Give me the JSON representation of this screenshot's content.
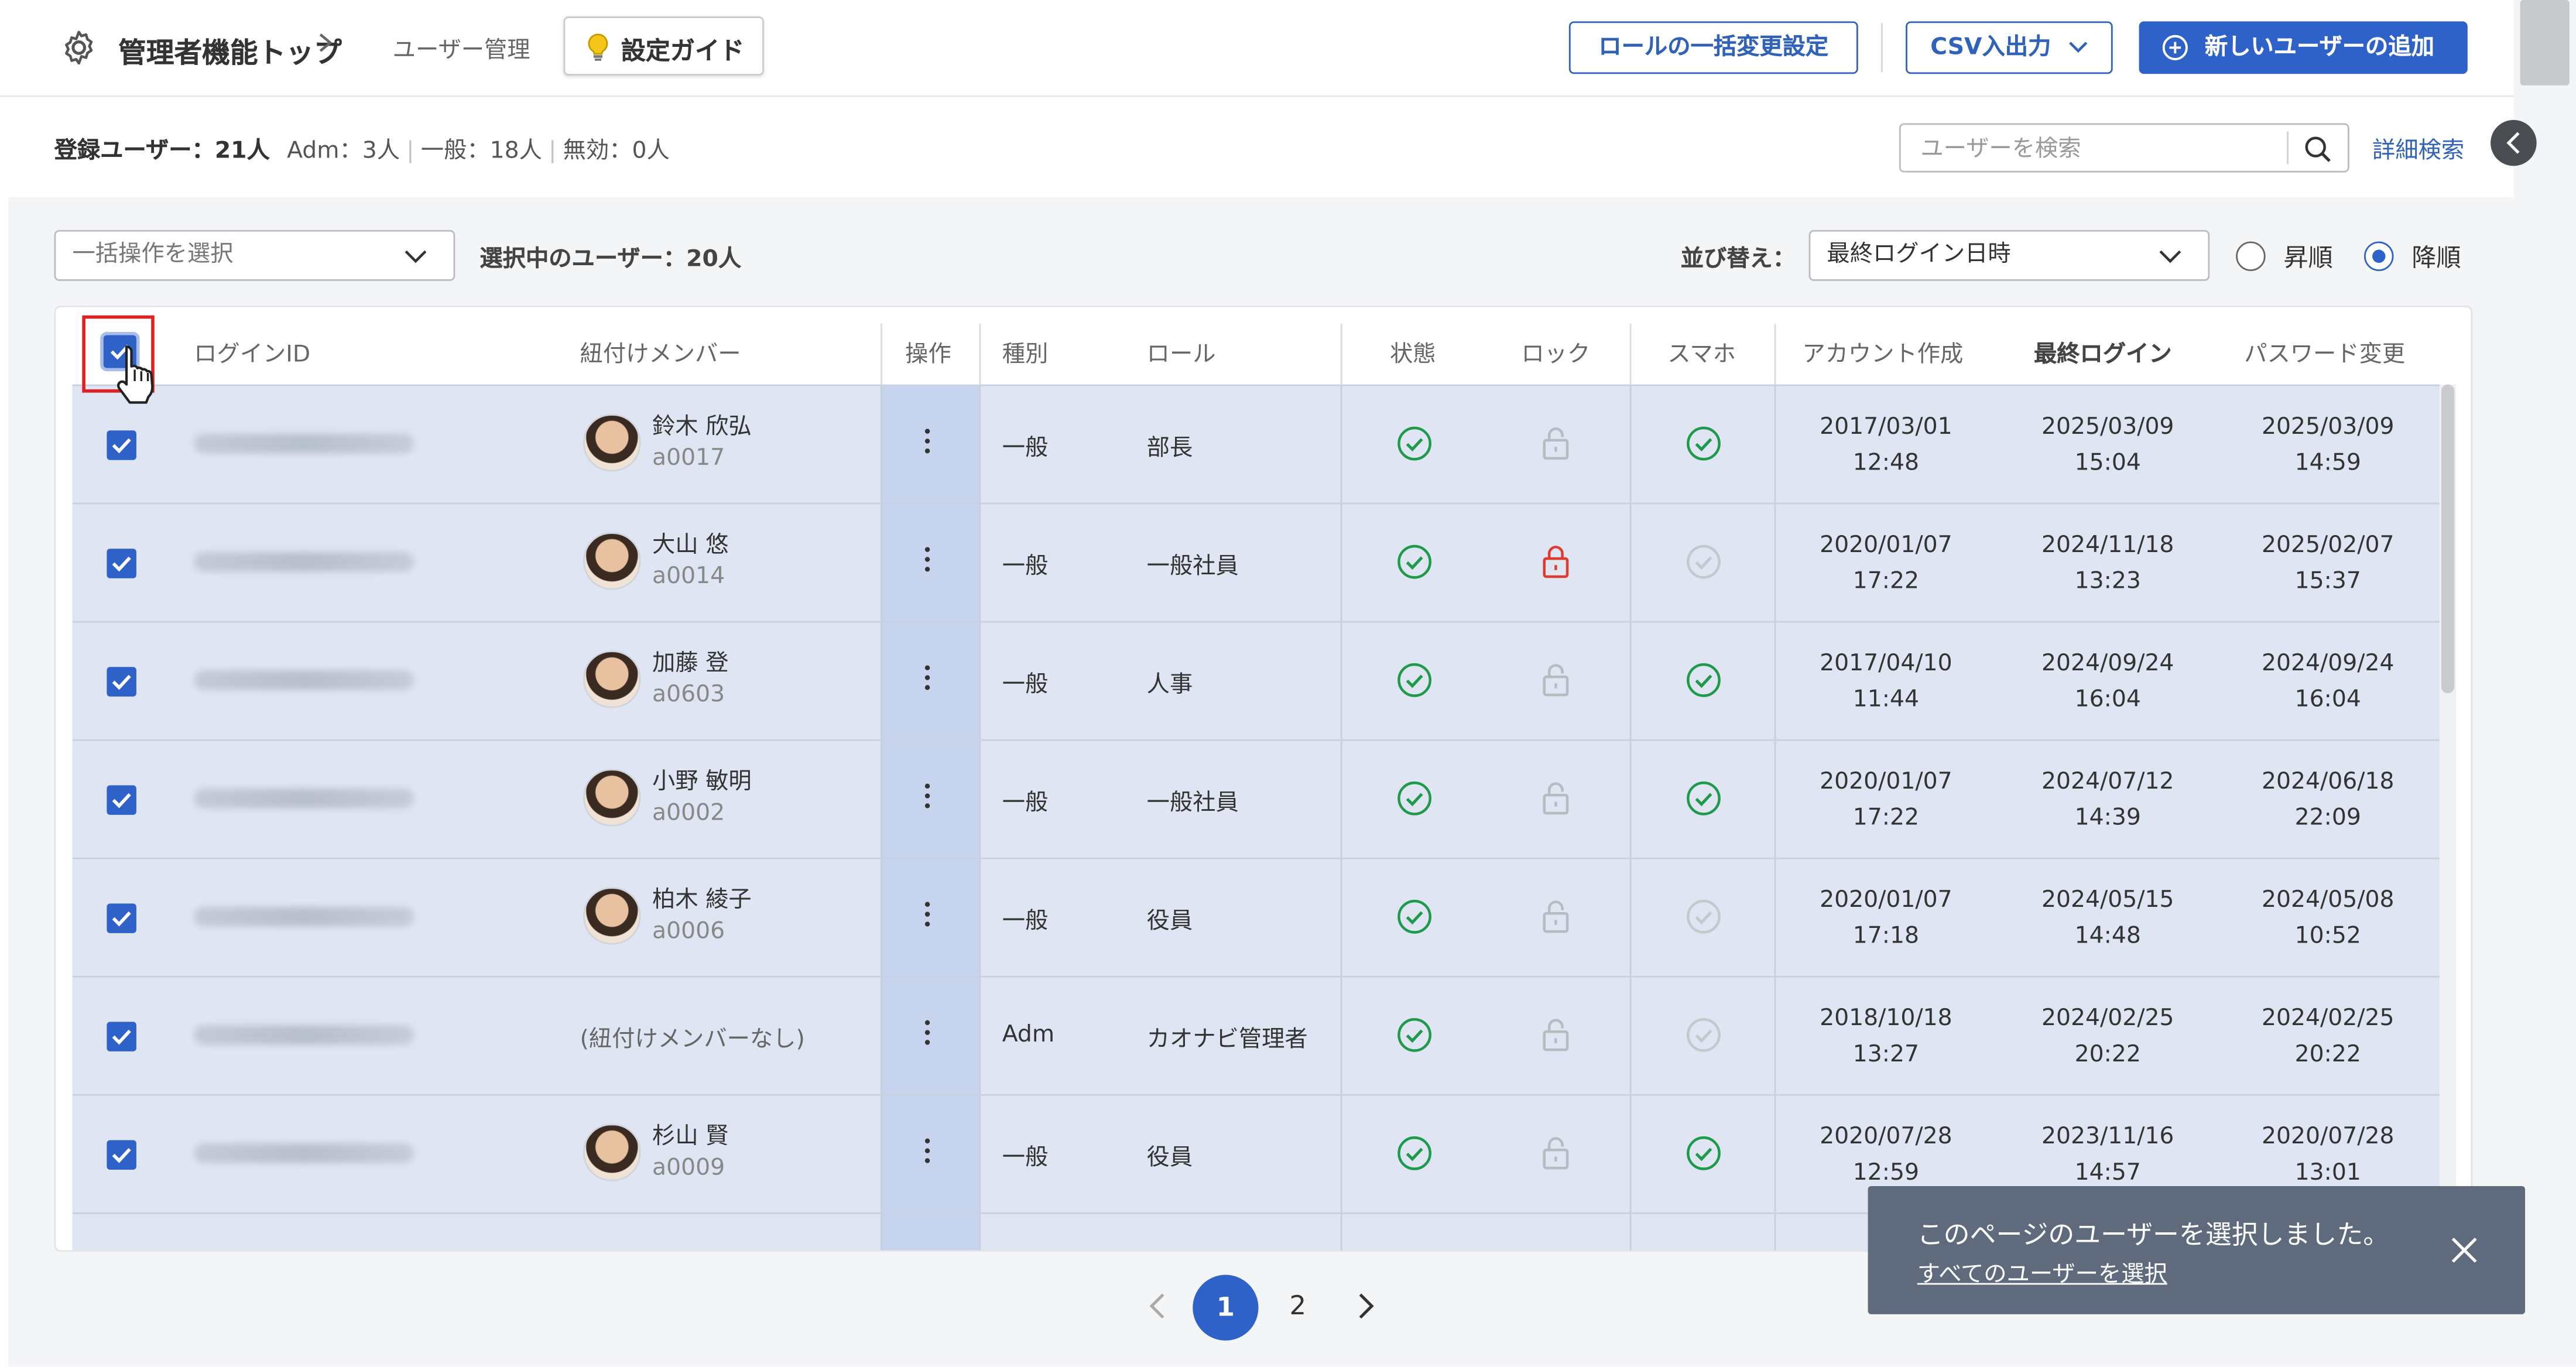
{
  "header": {
    "breadcrumb_top": "管理者機能トップ",
    "breadcrumb_current": "ユーザー管理",
    "guide_button": "設定ガイド",
    "role_bulk_button": "ロールの一括変更設定",
    "csv_button": "CSV入出力",
    "add_user_button": "新しいユーザーの追加"
  },
  "stats": {
    "registered_label": "登録ユーザー：21人",
    "adm": "Adm：3人",
    "general": "一般：18人",
    "disabled": "無効：0人"
  },
  "search": {
    "placeholder": "ユーザーを検索",
    "advanced_link": "詳細検索"
  },
  "toolbar": {
    "bulk_action_placeholder": "一括操作を選択",
    "selected_count": "選択中のユーザー：20人",
    "sort_label": "並び替え：",
    "sort_value": "最終ログイン日時",
    "asc_label": "昇順",
    "desc_label": "降順",
    "sort_order": "desc"
  },
  "table": {
    "columns": [
      "ログインID",
      "紐付けメンバー",
      "操作",
      "種別",
      "ロール",
      "状態",
      "ロック",
      "スマホ",
      "アカウント作成",
      "最終ログイン",
      "パスワード変更"
    ],
    "rows": [
      {
        "member_name": "鈴木 欣弘",
        "member_code": "a0017",
        "type": "一般",
        "role": "部長",
        "status": "active",
        "locked": false,
        "smartphone": true,
        "created": [
          "2017/03/01",
          "12:48"
        ],
        "last_login": [
          "2025/03/09",
          "15:04"
        ],
        "pw_changed": [
          "2025/03/09",
          "14:59"
        ]
      },
      {
        "member_name": "大山 悠",
        "member_code": "a0014",
        "type": "一般",
        "role": "一般社員",
        "status": "active",
        "locked": true,
        "smartphone": false,
        "created": [
          "2020/01/07",
          "17:22"
        ],
        "last_login": [
          "2024/11/18",
          "13:23"
        ],
        "pw_changed": [
          "2025/02/07",
          "15:37"
        ]
      },
      {
        "member_name": "加藤 登",
        "member_code": "a0603",
        "type": "一般",
        "role": "人事",
        "status": "active",
        "locked": false,
        "smartphone": true,
        "created": [
          "2017/04/10",
          "11:44"
        ],
        "last_login": [
          "2024/09/24",
          "16:04"
        ],
        "pw_changed": [
          "2024/09/24",
          "16:04"
        ]
      },
      {
        "member_name": "小野 敏明",
        "member_code": "a0002",
        "type": "一般",
        "role": "一般社員",
        "status": "active",
        "locked": false,
        "smartphone": true,
        "created": [
          "2020/01/07",
          "17:22"
        ],
        "last_login": [
          "2024/07/12",
          "14:39"
        ],
        "pw_changed": [
          "2024/06/18",
          "22:09"
        ]
      },
      {
        "member_name": "柏木 綾子",
        "member_code": "a0006",
        "type": "一般",
        "role": "役員",
        "status": "active",
        "locked": false,
        "smartphone": false,
        "created": [
          "2020/01/07",
          "17:18"
        ],
        "last_login": [
          "2024/05/15",
          "14:48"
        ],
        "pw_changed": [
          "2024/05/08",
          "10:52"
        ]
      },
      {
        "member_name": "",
        "member_code": "",
        "member_none": "(紐付けメンバーなし)",
        "type": "Adm",
        "role": "カオナビ管理者",
        "status": "active",
        "locked": false,
        "smartphone": false,
        "created": [
          "2018/10/18",
          "13:27"
        ],
        "last_login": [
          "2024/02/25",
          "20:22"
        ],
        "pw_changed": [
          "2024/02/25",
          "20:22"
        ]
      },
      {
        "member_name": "杉山 賢",
        "member_code": "a0009",
        "type": "一般",
        "role": "役員",
        "status": "active",
        "locked": false,
        "smartphone": true,
        "created": [
          "2020/07/28",
          "12:59"
        ],
        "last_login": [
          "2023/11/16",
          "14:57"
        ],
        "pw_changed": [
          "2020/07/28",
          "13:01"
        ]
      }
    ]
  },
  "pagination": {
    "current": "1",
    "next_page": "2"
  },
  "toast": {
    "message": "このページのユーザーを選択しました。",
    "link": "すべてのユーザーを選択"
  },
  "colors": {
    "accent": "#2f62c8",
    "selected_row": "#dfe5f3",
    "ok_green": "#1f9a4a",
    "lock_red": "#e03b2f",
    "toast_bg": "#5f6b7c"
  }
}
